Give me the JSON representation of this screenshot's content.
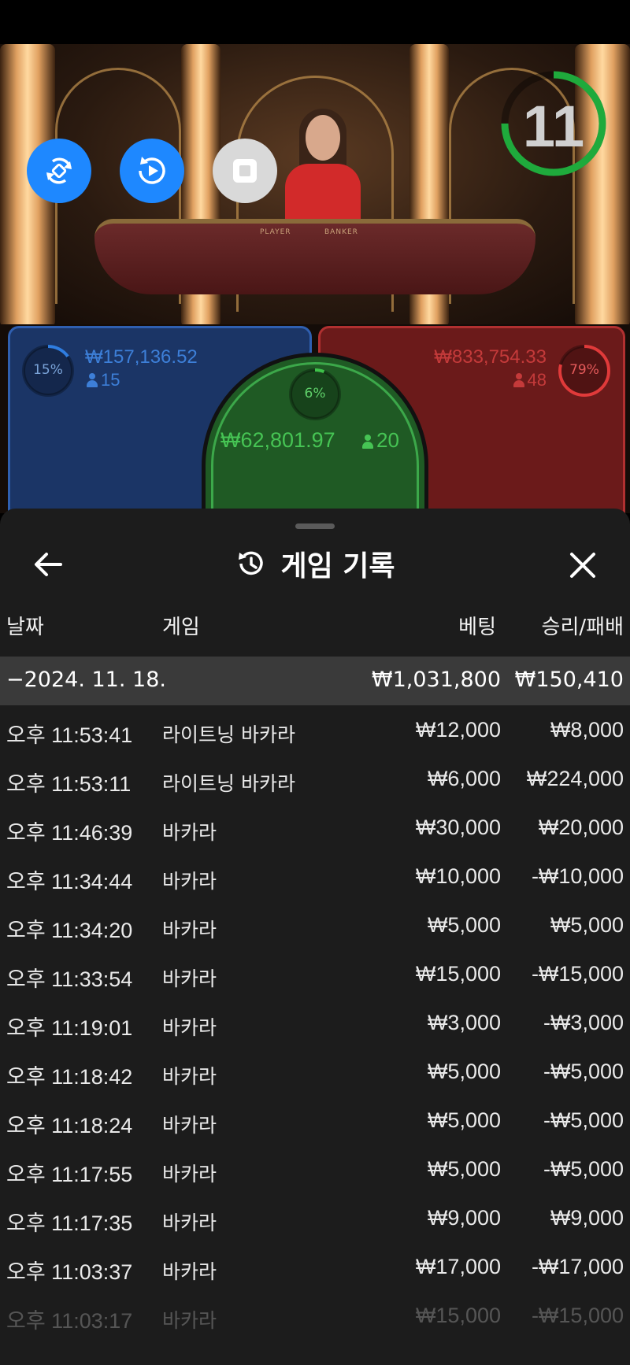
{
  "game": {
    "timer": "11",
    "timer_progress": 0.75,
    "table_labels": {
      "player": "PLAYER",
      "banker": "BANKER"
    },
    "player": {
      "percent": "15%",
      "percent_value": 0.15,
      "amount": "₩157,136.52",
      "people": "15",
      "color": "#2f7de0"
    },
    "tie": {
      "percent": "6%",
      "percent_value": 0.06,
      "amount": "₩62,801.97",
      "people": "20",
      "color": "#3ec24a"
    },
    "banker": {
      "percent": "79%",
      "percent_value": 0.79,
      "amount": "₩833,754.33",
      "people": "48",
      "color": "#e03a3a"
    },
    "controls": [
      {
        "name": "swap-icon"
      },
      {
        "name": "replay-icon"
      },
      {
        "name": "stop-icon"
      }
    ]
  },
  "history": {
    "title": "게임 기록",
    "icons": {
      "back": "arrow-left-icon",
      "history": "history-icon",
      "close": "close-icon"
    },
    "columns": {
      "date": "날짜",
      "game": "게임",
      "bet": "베팅",
      "win_loss": "승리/패배"
    },
    "day": {
      "date": "−2024. 11. 18.",
      "bet": "₩1,031,800",
      "win_loss": "₩150,410"
    },
    "rows": [
      {
        "time": "오후 11:53:41",
        "game": "라이트닝 바카라",
        "bet": "₩12,000",
        "win_loss": "₩8,000"
      },
      {
        "time": "오후 11:53:11",
        "game": "라이트닝 바카라",
        "bet": "₩6,000",
        "win_loss": "₩224,000"
      },
      {
        "time": "오후 11:46:39",
        "game": "바카라",
        "bet": "₩30,000",
        "win_loss": "₩20,000"
      },
      {
        "time": "오후 11:34:44",
        "game": "바카라",
        "bet": "₩10,000",
        "win_loss": "-₩10,000"
      },
      {
        "time": "오후 11:34:20",
        "game": "바카라",
        "bet": "₩5,000",
        "win_loss": "₩5,000"
      },
      {
        "time": "오후 11:33:54",
        "game": "바카라",
        "bet": "₩15,000",
        "win_loss": "-₩15,000"
      },
      {
        "time": "오후 11:19:01",
        "game": "바카라",
        "bet": "₩3,000",
        "win_loss": "-₩3,000"
      },
      {
        "time": "오후 11:18:42",
        "game": "바카라",
        "bet": "₩5,000",
        "win_loss": "-₩5,000"
      },
      {
        "time": "오후 11:18:24",
        "game": "바카라",
        "bet": "₩5,000",
        "win_loss": "-₩5,000"
      },
      {
        "time": "오후 11:17:55",
        "game": "바카라",
        "bet": "₩5,000",
        "win_loss": "-₩5,000"
      },
      {
        "time": "오후 11:17:35",
        "game": "바카라",
        "bet": "₩9,000",
        "win_loss": "₩9,000"
      },
      {
        "time": "오후 11:03:37",
        "game": "바카라",
        "bet": "₩17,000",
        "win_loss": "-₩17,000"
      },
      {
        "time": "오후 11:03:17",
        "game": "바카라",
        "bet": "₩15,000",
        "win_loss": "-₩15,000"
      }
    ]
  }
}
